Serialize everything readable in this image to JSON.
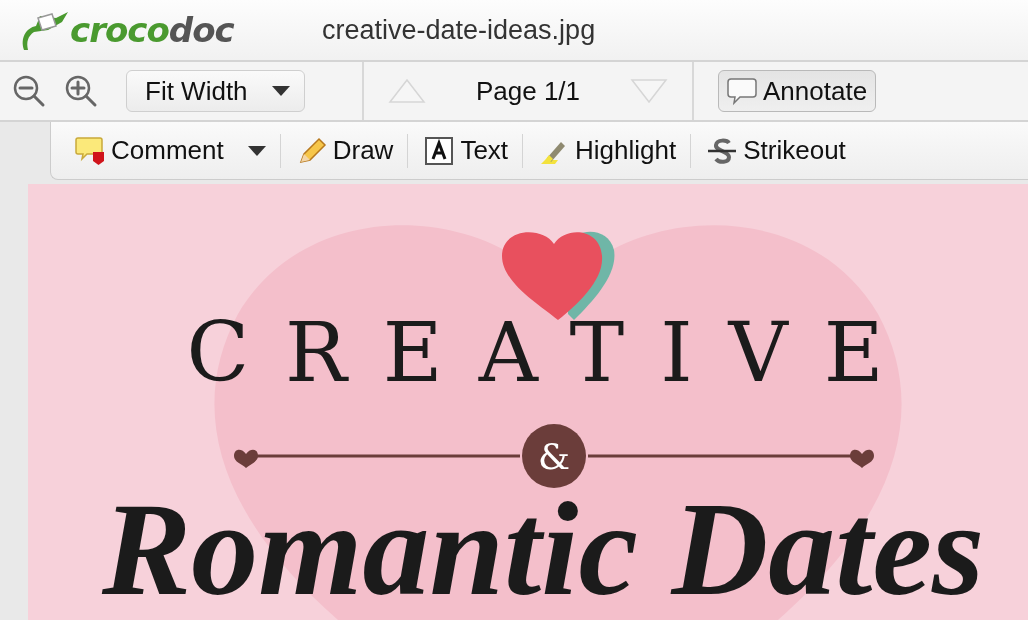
{
  "app": {
    "logo": [
      "croco",
      "doc"
    ],
    "file_name": "creative-date-ideas.jpg"
  },
  "toolbar": {
    "zoom_mode": "Fit Width",
    "previous_page": {
      "disabled": true
    },
    "page_label": "Page 1/1",
    "next_page": {
      "disabled": true
    },
    "annotate": {
      "label": "Annotate",
      "selected": true
    }
  },
  "annotation_tools": [
    {
      "kind": "comment",
      "label": "Comment",
      "has_menu": true
    },
    {
      "kind": "draw",
      "label": "Draw",
      "has_menu": false
    },
    {
      "kind": "text",
      "label": "Text",
      "has_menu": false
    },
    {
      "kind": "highlight",
      "label": "Highlight",
      "has_menu": false
    },
    {
      "kind": "strikeout",
      "label": "Strikeout",
      "has_menu": false
    }
  ],
  "document": {
    "heading": "CREATIVE",
    "ampersand": "&",
    "script_heading": "Romantic Dates"
  }
}
